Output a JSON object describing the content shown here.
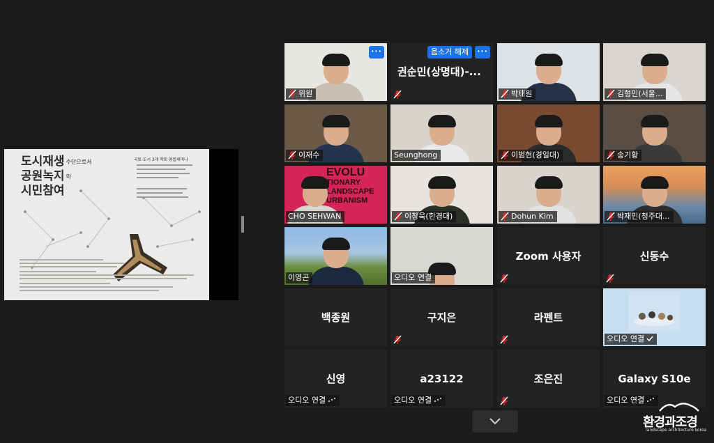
{
  "share": {
    "title_line1": "도시재생",
    "title_line1_suffix": "수단으로서",
    "title_line2": "공원녹지",
    "title_line2_suffix": "와",
    "title_line3": "시민참여",
    "seminar": "국토·도시 3개 학회 융합세미나"
  },
  "tiles": [
    {
      "name": "위원",
      "muted": true,
      "has_menu": true
    },
    {
      "name": "권순민(상명대)-...",
      "muted": true,
      "unmute_label": "음소거 해제",
      "has_menu": true
    },
    {
      "name": "박태원",
      "muted": true
    },
    {
      "name": "김형민(서울...",
      "muted": true
    },
    {
      "name": "이재수",
      "muted": true
    },
    {
      "name": "Seunghong",
      "muted": false
    },
    {
      "name": "이범현(경일대)",
      "muted": true
    },
    {
      "name": "송기황",
      "muted": true
    },
    {
      "name": "CHO SEHWAN",
      "muted": false
    },
    {
      "name": "이창욱(한경대)",
      "muted": true
    },
    {
      "name": "Dohun Kim",
      "muted": true
    },
    {
      "name": "박재민(청주대...",
      "muted": true,
      "active": true
    },
    {
      "name": "이영곤",
      "muted": false
    },
    {
      "name": "오디오 연결",
      "muted": false
    },
    {
      "name": "Zoom 사용자",
      "muted": true
    },
    {
      "name": "신동수",
      "muted": true
    },
    {
      "name": "백종원",
      "muted": false
    },
    {
      "name": "구지은",
      "muted": true
    },
    {
      "name": "라펜트",
      "muted": true
    },
    {
      "name": "오디오 연결",
      "muted": false
    },
    {
      "name": "신영",
      "caption": "오디오 연결"
    },
    {
      "name": "a23122",
      "caption": "오디오 연결"
    },
    {
      "name": "조은진",
      "muted": true
    },
    {
      "name": "Galaxy S10e",
      "caption": "오디오 연결"
    }
  ],
  "slide_banner": {
    "line1": "EVOLU",
    "line2": "TIONARY",
    "line3": "LANDSCAPE",
    "line4": "URBANISM"
  },
  "watermark": {
    "title": "환경과조경",
    "subtitle": "landscape architecture korea"
  },
  "colors": {
    "accent": "#1a73e8",
    "active_speaker": "#c6e05a",
    "mic_off": "#e02828"
  },
  "icons": {
    "mic_off": "mic-off-icon",
    "menu": "more-icon",
    "expand": "chevron-down-icon",
    "connecting": "connecting-dots-icon"
  }
}
